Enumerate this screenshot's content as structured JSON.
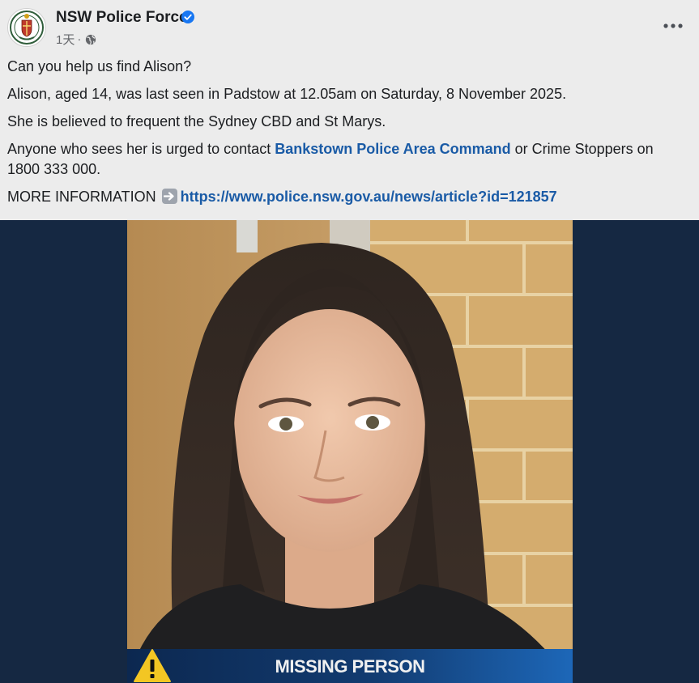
{
  "header": {
    "page_name": "NSW Police Force",
    "time": "1天",
    "separator": "·",
    "avatar_icon": "nsw-police-crest",
    "verified_icon": "verified-badge-icon",
    "privacy_icon": "globe-icon",
    "more_icon": "more-options-icon"
  },
  "post": {
    "line1": "Can you help us find Alison?",
    "line2": "Alison, aged 14, was last seen in Padstow at 12.05am on Saturday, 8 November 2025.",
    "line3": "She is believed to frequent the Sydney CBD and St Marys.",
    "line4_pre": "Anyone who sees her is urged to contact ",
    "line4_link": "Bankstown Police Area Command",
    "line4_post": " or Crime Stoppers on 1800 333 000.",
    "more_info_label": "MORE INFORMATION",
    "more_info_icon": "right-arrow-icon",
    "more_info_url": "https://www.police.nsw.gov.au/news/article?id=121857"
  },
  "image": {
    "banner_text": "MISSING PERSON",
    "warning_icon": "warning-triangle-icon",
    "colors": {
      "background": "#152842",
      "banner_dark": "#0c2850",
      "banner_light": "#1d67b8",
      "warning": "#f3c623"
    }
  },
  "colors": {
    "link": "#1a5ba6",
    "verified": "#1877f2",
    "muted": "#65676b"
  }
}
